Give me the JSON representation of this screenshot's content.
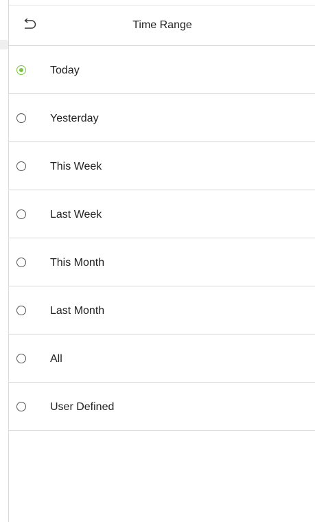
{
  "header": {
    "title": "Time Range",
    "back_icon": "back-arrow-icon"
  },
  "options": [
    {
      "label": "Today",
      "selected": true
    },
    {
      "label": "Yesterday",
      "selected": false
    },
    {
      "label": "This Week",
      "selected": false
    },
    {
      "label": "Last Week",
      "selected": false
    },
    {
      "label": "This Month",
      "selected": false
    },
    {
      "label": "Last Month",
      "selected": false
    },
    {
      "label": "All",
      "selected": false
    },
    {
      "label": "User Defined",
      "selected": false
    }
  ],
  "colors": {
    "accent": "#7ac943",
    "divider": "#d6d6d6",
    "text": "#222222"
  }
}
